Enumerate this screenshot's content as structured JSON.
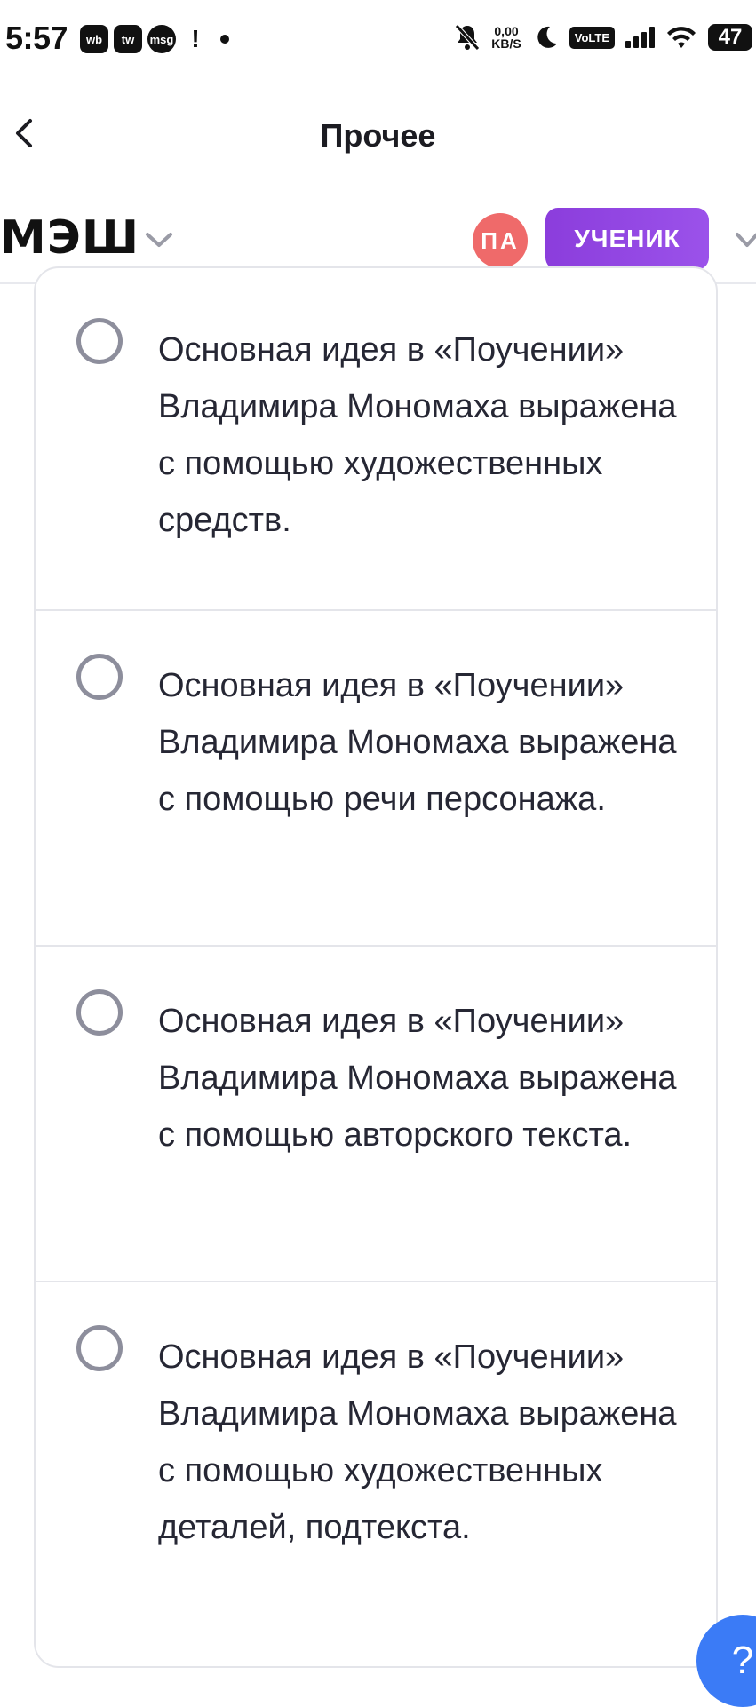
{
  "status_bar": {
    "time": "5:57",
    "app_icons": [
      "wb",
      "tw",
      "msg",
      "!"
    ],
    "net_speed_value": "0,00",
    "net_speed_unit": "KB/S",
    "volte": "VoLTE",
    "battery": "47"
  },
  "header": {
    "title": "Прочее"
  },
  "appbar": {
    "logo": "МЭШ",
    "avatar_initials": "ПА",
    "role": "УЧЕНИК"
  },
  "options": [
    {
      "text": "Основная идея в «Поучении» Владимира Мономаха выражена с помощью художественных средств."
    },
    {
      "text": "Основная идея в «Поучении» Владимира Мономаха выражена с помощью речи персонажа."
    },
    {
      "text": "Основная идея в «Поучении» Владимира Мономаха выражена с помощью авторского текста."
    },
    {
      "text": "Основная идея в «Поучении» Владимира Мономаха выражена с помощью художественных деталей, подтекста."
    }
  ],
  "help_button": "?",
  "colors": {
    "accent_purple": "#8b3ddc",
    "avatar_red": "#ef6a6a",
    "help_blue": "#3b7bf6",
    "radio_gray": "#8d8e9c"
  }
}
